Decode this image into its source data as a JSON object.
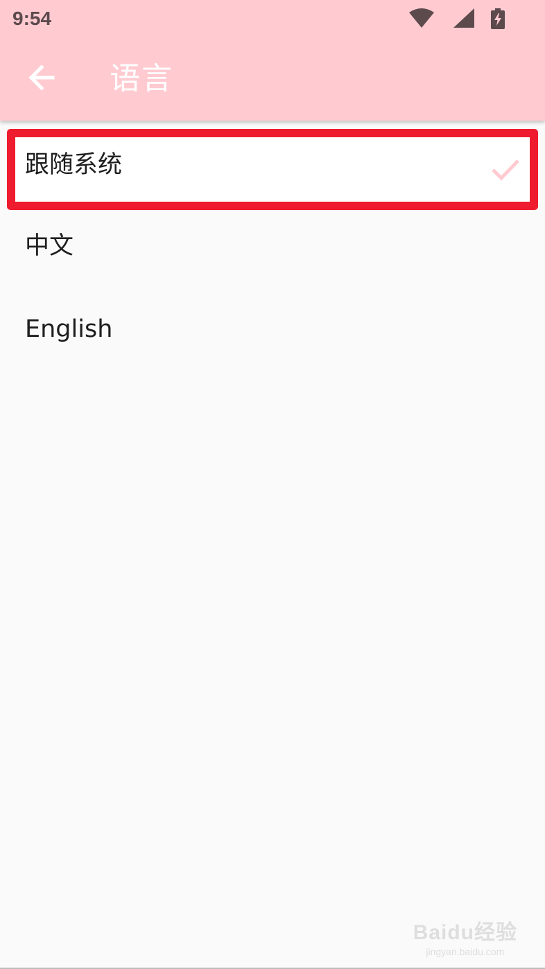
{
  "status_bar": {
    "time": "9:54",
    "icons": [
      "wifi-icon",
      "signal-icon",
      "battery-charging-icon"
    ]
  },
  "toolbar": {
    "back_icon": "arrow-left-icon",
    "title": "语言"
  },
  "languages": {
    "items": [
      {
        "label": "跟随系统",
        "selected": true
      },
      {
        "label": "中文",
        "selected": false
      },
      {
        "label": "English",
        "selected": false
      }
    ],
    "selected_icon": "check-icon"
  },
  "watermark": {
    "brand": "Baidu经验",
    "url": "jingyan.baidu.com"
  },
  "colors": {
    "header_bg": "#ffcbd1",
    "page_bg": "#fafafa",
    "highlight_border": "#ee1c2e",
    "check": "#ffcbd1",
    "text_primary": "#1e1e1e",
    "title_text": "#ffffff",
    "status_text": "#5c4a4d"
  }
}
